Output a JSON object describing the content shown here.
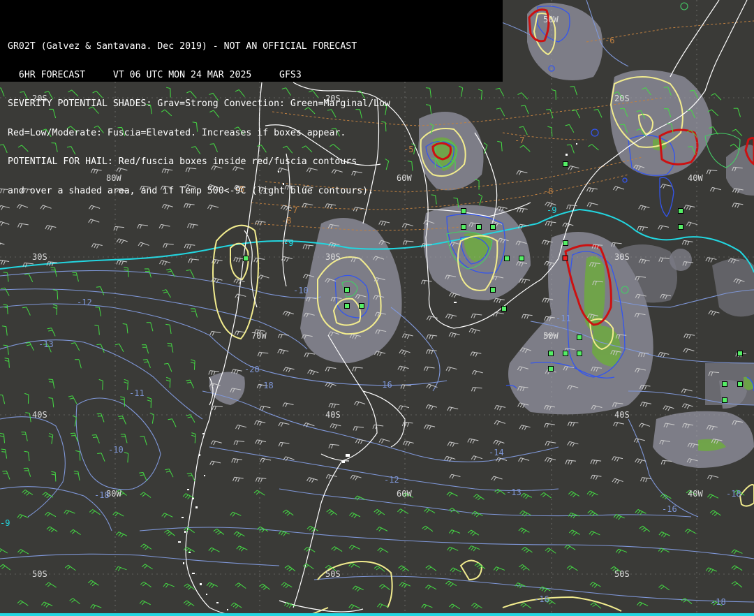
{
  "header": {
    "lines": [
      "GR02T (Galvez & Santavana. Dec 2019) - NOT AN OFFICIAL FORECAST",
      "  6HR FORECAST     VT 06 UTC MON 24 MAR 2025     GFS3",
      "SEVERITY POTENTIAL SHADES: Grav=Strong Convection: Green=Marginal/Low",
      "Red=Low/Moderate: Fuscia=Elevated. Increases if boxes appear.",
      "POTENTIAL FOR HAIL: Red/fuscia boxes inside red/fuscia contours",
      "and over a shaded area, and if Temp 500<-9C (light blue contours)."
    ]
  },
  "grid_labels": {
    "lat_20": "20S",
    "lat_30": "30S",
    "lat_40": "40S",
    "lat_50": "50S",
    "lon_80": "80W",
    "lon_70": "70W",
    "lon_60": "60W",
    "lon_50": "50W",
    "lon_40": "40W"
  },
  "contour_labels": {
    "temp_minus5": "-5",
    "temp_minus6": "-6",
    "temp_minus7": "-7",
    "temp_minus8": "-8",
    "temp_minus9": "-9",
    "temp_minus10": "-10",
    "temp_minus11": "-11",
    "temp_minus12": "-12",
    "temp_minus13": "-13",
    "temp_minus14": "-14",
    "temp_minus16": "-16",
    "temp_minus18": "-18",
    "temp_minus20": "-20"
  },
  "colors": {
    "background": "#3a3a37",
    "shade_gray": "#8a8a96",
    "shade_green": "#6fa844",
    "contour_yellow": "#f2ec8e",
    "contour_red": "#cc1111",
    "contour_blue": "#3355ee",
    "contour_lightblue": "#7f97d8",
    "isotherm_cyan": "#22d6e0",
    "isotherm_orange": "#c08040",
    "boxes_green": "#55ee66",
    "wind_barb_green": "#44dd44",
    "wind_barb_white": "#dddddd",
    "coast_white": "#ffffff"
  }
}
